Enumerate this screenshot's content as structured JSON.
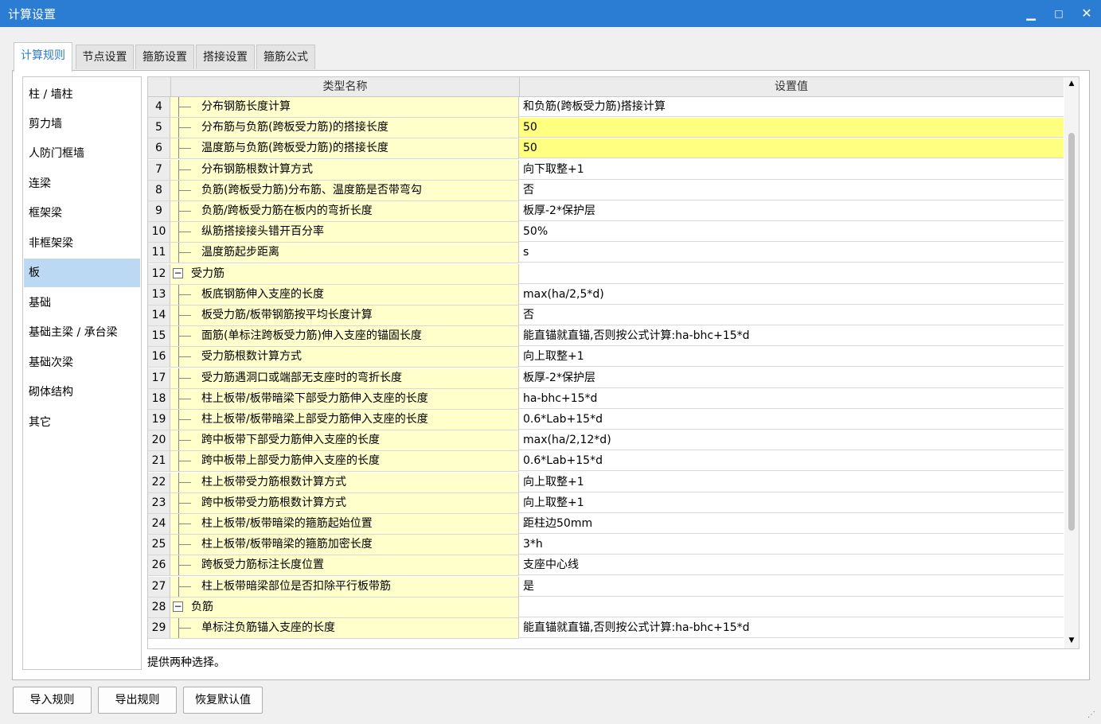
{
  "window": {
    "title": "计算设置",
    "min_glyph": "▁",
    "max_glyph": "□",
    "close_glyph": "✕"
  },
  "tabs": [
    {
      "label": "计算规则",
      "active": true
    },
    {
      "label": "节点设置",
      "active": false
    },
    {
      "label": "箍筋设置",
      "active": false
    },
    {
      "label": "搭接设置",
      "active": false
    },
    {
      "label": "箍筋公式",
      "active": false
    }
  ],
  "sidebar": {
    "items": [
      {
        "label": "柱 / 墙柱",
        "selected": false
      },
      {
        "label": "剪力墙",
        "selected": false
      },
      {
        "label": "人防门框墙",
        "selected": false
      },
      {
        "label": "连梁",
        "selected": false
      },
      {
        "label": "框架梁",
        "selected": false
      },
      {
        "label": "非框架梁",
        "selected": false
      },
      {
        "label": "板",
        "selected": true
      },
      {
        "label": "基础",
        "selected": false
      },
      {
        "label": "基础主梁 / 承台梁",
        "selected": false
      },
      {
        "label": "基础次梁",
        "selected": false
      },
      {
        "label": "砌体结构",
        "selected": false
      },
      {
        "label": "其它",
        "selected": false
      }
    ]
  },
  "grid": {
    "headers": {
      "name": "类型名称",
      "value": "设置值"
    },
    "rows": [
      {
        "num": "4",
        "name": "分布钢筋长度计算",
        "value": "和负筋(跨板受力筋)搭接计算",
        "group": false,
        "highlight": false
      },
      {
        "num": "5",
        "name": "分布筋与负筋(跨板受力筋)的搭接长度",
        "value": "50",
        "group": false,
        "highlight": true
      },
      {
        "num": "6",
        "name": "温度筋与负筋(跨板受力筋)的搭接长度",
        "value": "50",
        "group": false,
        "highlight": true
      },
      {
        "num": "7",
        "name": "分布钢筋根数计算方式",
        "value": "向下取整+1",
        "group": false,
        "highlight": false
      },
      {
        "num": "8",
        "name": "负筋(跨板受力筋)分布筋、温度筋是否带弯勾",
        "value": "否",
        "group": false,
        "highlight": false
      },
      {
        "num": "9",
        "name": "负筋/跨板受力筋在板内的弯折长度",
        "value": "板厚-2*保护层",
        "group": false,
        "highlight": false
      },
      {
        "num": "10",
        "name": "纵筋搭接接头错开百分率",
        "value": "50%",
        "group": false,
        "highlight": false
      },
      {
        "num": "11",
        "name": "温度筋起步距离",
        "value": "s",
        "group": false,
        "highlight": false
      },
      {
        "num": "12",
        "name": "受力筋",
        "value": "",
        "group": true,
        "highlight": false
      },
      {
        "num": "13",
        "name": "板底钢筋伸入支座的长度",
        "value": "max(ha/2,5*d)",
        "group": false,
        "highlight": false
      },
      {
        "num": "14",
        "name": "板受力筋/板带钢筋按平均长度计算",
        "value": "否",
        "group": false,
        "highlight": false
      },
      {
        "num": "15",
        "name": "面筋(单标注跨板受力筋)伸入支座的锚固长度",
        "value": "能直锚就直锚,否则按公式计算:ha-bhc+15*d",
        "group": false,
        "highlight": false
      },
      {
        "num": "16",
        "name": "受力筋根数计算方式",
        "value": "向上取整+1",
        "group": false,
        "highlight": false
      },
      {
        "num": "17",
        "name": "受力筋遇洞口或端部无支座时的弯折长度",
        "value": "板厚-2*保护层",
        "group": false,
        "highlight": false
      },
      {
        "num": "18",
        "name": "柱上板带/板带暗梁下部受力筋伸入支座的长度",
        "value": "ha-bhc+15*d",
        "group": false,
        "highlight": false
      },
      {
        "num": "19",
        "name": "柱上板带/板带暗梁上部受力筋伸入支座的长度",
        "value": "0.6*Lab+15*d",
        "group": false,
        "highlight": false
      },
      {
        "num": "20",
        "name": "跨中板带下部受力筋伸入支座的长度",
        "value": "max(ha/2,12*d)",
        "group": false,
        "highlight": false
      },
      {
        "num": "21",
        "name": "跨中板带上部受力筋伸入支座的长度",
        "value": "0.6*Lab+15*d",
        "group": false,
        "highlight": false
      },
      {
        "num": "22",
        "name": "柱上板带受力筋根数计算方式",
        "value": "向上取整+1",
        "group": false,
        "highlight": false
      },
      {
        "num": "23",
        "name": "跨中板带受力筋根数计算方式",
        "value": "向上取整+1",
        "group": false,
        "highlight": false
      },
      {
        "num": "24",
        "name": "柱上板带/板带暗梁的箍筋起始位置",
        "value": "距柱边50mm",
        "group": false,
        "highlight": false
      },
      {
        "num": "25",
        "name": "柱上板带/板带暗梁的箍筋加密长度",
        "value": "3*h",
        "group": false,
        "highlight": false
      },
      {
        "num": "26",
        "name": "跨板受力筋标注长度位置",
        "value": "支座中心线",
        "group": false,
        "highlight": false
      },
      {
        "num": "27",
        "name": "柱上板带暗梁部位是否扣除平行板带筋",
        "value": "是",
        "group": false,
        "highlight": false
      },
      {
        "num": "28",
        "name": "负筋",
        "value": "",
        "group": true,
        "highlight": false
      },
      {
        "num": "29",
        "name": "单标注负筋锚入支座的长度",
        "value": "能直锚就直锚,否则按公式计算:ha-bhc+15*d",
        "group": false,
        "highlight": false
      }
    ],
    "collapse_glyph": "−",
    "scroll_up_glyph": "▲",
    "scroll_down_glyph": "▼"
  },
  "description": "提供两种选择。",
  "buttons": {
    "import": "导入规则",
    "export": "导出规则",
    "restore": "恢复默认值"
  },
  "colors": {
    "titlebar": "#2b7cd3",
    "name_cell_bg": "#ffffcc",
    "highlight_value_bg": "#ffff80",
    "selected_sidebar_bg": "#bcd9f3"
  }
}
